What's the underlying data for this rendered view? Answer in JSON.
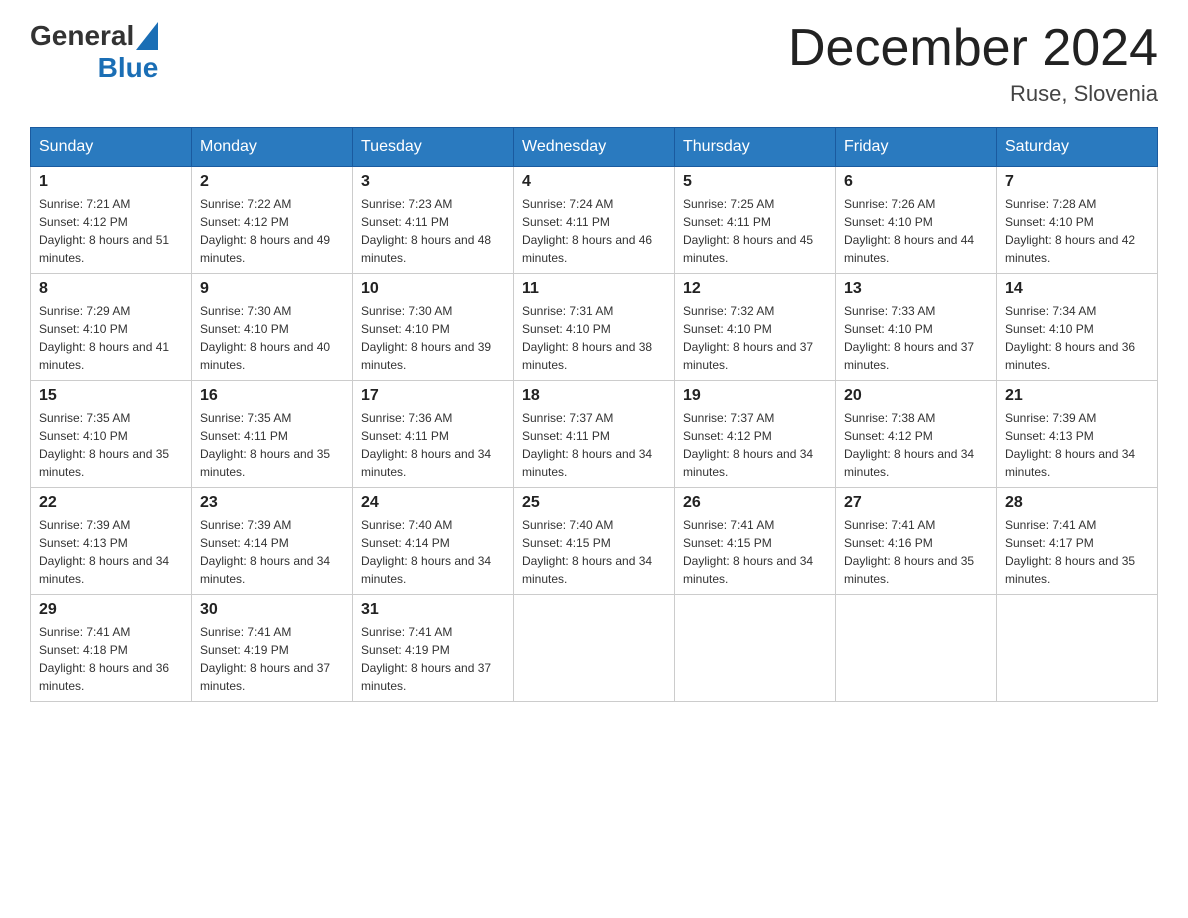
{
  "header": {
    "logo_general": "General",
    "logo_blue": "Blue",
    "month_title": "December 2024",
    "location": "Ruse, Slovenia"
  },
  "weekdays": [
    "Sunday",
    "Monday",
    "Tuesday",
    "Wednesday",
    "Thursday",
    "Friday",
    "Saturday"
  ],
  "weeks": [
    [
      {
        "day": "1",
        "sunrise": "7:21 AM",
        "sunset": "4:12 PM",
        "daylight": "8 hours and 51 minutes."
      },
      {
        "day": "2",
        "sunrise": "7:22 AM",
        "sunset": "4:12 PM",
        "daylight": "8 hours and 49 minutes."
      },
      {
        "day": "3",
        "sunrise": "7:23 AM",
        "sunset": "4:11 PM",
        "daylight": "8 hours and 48 minutes."
      },
      {
        "day": "4",
        "sunrise": "7:24 AM",
        "sunset": "4:11 PM",
        "daylight": "8 hours and 46 minutes."
      },
      {
        "day": "5",
        "sunrise": "7:25 AM",
        "sunset": "4:11 PM",
        "daylight": "8 hours and 45 minutes."
      },
      {
        "day": "6",
        "sunrise": "7:26 AM",
        "sunset": "4:10 PM",
        "daylight": "8 hours and 44 minutes."
      },
      {
        "day": "7",
        "sunrise": "7:28 AM",
        "sunset": "4:10 PM",
        "daylight": "8 hours and 42 minutes."
      }
    ],
    [
      {
        "day": "8",
        "sunrise": "7:29 AM",
        "sunset": "4:10 PM",
        "daylight": "8 hours and 41 minutes."
      },
      {
        "day": "9",
        "sunrise": "7:30 AM",
        "sunset": "4:10 PM",
        "daylight": "8 hours and 40 minutes."
      },
      {
        "day": "10",
        "sunrise": "7:30 AM",
        "sunset": "4:10 PM",
        "daylight": "8 hours and 39 minutes."
      },
      {
        "day": "11",
        "sunrise": "7:31 AM",
        "sunset": "4:10 PM",
        "daylight": "8 hours and 38 minutes."
      },
      {
        "day": "12",
        "sunrise": "7:32 AM",
        "sunset": "4:10 PM",
        "daylight": "8 hours and 37 minutes."
      },
      {
        "day": "13",
        "sunrise": "7:33 AM",
        "sunset": "4:10 PM",
        "daylight": "8 hours and 37 minutes."
      },
      {
        "day": "14",
        "sunrise": "7:34 AM",
        "sunset": "4:10 PM",
        "daylight": "8 hours and 36 minutes."
      }
    ],
    [
      {
        "day": "15",
        "sunrise": "7:35 AM",
        "sunset": "4:10 PM",
        "daylight": "8 hours and 35 minutes."
      },
      {
        "day": "16",
        "sunrise": "7:35 AM",
        "sunset": "4:11 PM",
        "daylight": "8 hours and 35 minutes."
      },
      {
        "day": "17",
        "sunrise": "7:36 AM",
        "sunset": "4:11 PM",
        "daylight": "8 hours and 34 minutes."
      },
      {
        "day": "18",
        "sunrise": "7:37 AM",
        "sunset": "4:11 PM",
        "daylight": "8 hours and 34 minutes."
      },
      {
        "day": "19",
        "sunrise": "7:37 AM",
        "sunset": "4:12 PM",
        "daylight": "8 hours and 34 minutes."
      },
      {
        "day": "20",
        "sunrise": "7:38 AM",
        "sunset": "4:12 PM",
        "daylight": "8 hours and 34 minutes."
      },
      {
        "day": "21",
        "sunrise": "7:39 AM",
        "sunset": "4:13 PM",
        "daylight": "8 hours and 34 minutes."
      }
    ],
    [
      {
        "day": "22",
        "sunrise": "7:39 AM",
        "sunset": "4:13 PM",
        "daylight": "8 hours and 34 minutes."
      },
      {
        "day": "23",
        "sunrise": "7:39 AM",
        "sunset": "4:14 PM",
        "daylight": "8 hours and 34 minutes."
      },
      {
        "day": "24",
        "sunrise": "7:40 AM",
        "sunset": "4:14 PM",
        "daylight": "8 hours and 34 minutes."
      },
      {
        "day": "25",
        "sunrise": "7:40 AM",
        "sunset": "4:15 PM",
        "daylight": "8 hours and 34 minutes."
      },
      {
        "day": "26",
        "sunrise": "7:41 AM",
        "sunset": "4:15 PM",
        "daylight": "8 hours and 34 minutes."
      },
      {
        "day": "27",
        "sunrise": "7:41 AM",
        "sunset": "4:16 PM",
        "daylight": "8 hours and 35 minutes."
      },
      {
        "day": "28",
        "sunrise": "7:41 AM",
        "sunset": "4:17 PM",
        "daylight": "8 hours and 35 minutes."
      }
    ],
    [
      {
        "day": "29",
        "sunrise": "7:41 AM",
        "sunset": "4:18 PM",
        "daylight": "8 hours and 36 minutes."
      },
      {
        "day": "30",
        "sunrise": "7:41 AM",
        "sunset": "4:19 PM",
        "daylight": "8 hours and 37 minutes."
      },
      {
        "day": "31",
        "sunrise": "7:41 AM",
        "sunset": "4:19 PM",
        "daylight": "8 hours and 37 minutes."
      },
      null,
      null,
      null,
      null
    ]
  ]
}
